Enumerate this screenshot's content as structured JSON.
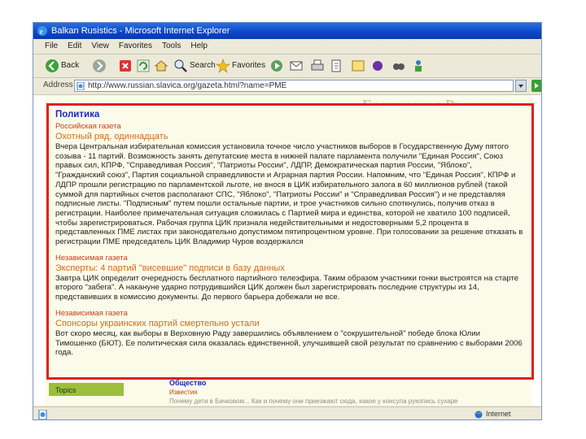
{
  "window": {
    "title": "Balkan Rusistics - Microsoft Internet Explorer"
  },
  "menu": [
    "File",
    "Edit",
    "View",
    "Favorites",
    "Tools",
    "Help"
  ],
  "toolbar": {
    "back_label": "Back",
    "search_label": "Search",
    "favorites_label": "Favorites"
  },
  "address": {
    "label": "Address",
    "url": "http://www.russian.slavica.org/gazeta.html?name=PME"
  },
  "page": {
    "faded_header": "Балканская Русистика",
    "section": "Политика",
    "articles": [
      {
        "source": "Российская газета",
        "headline": "Охотный ряд, одиннадцать",
        "text": "Вчера Центральная избирательная комиссия установила точное число участников выборов в Государственную Думу пятого созыва - 11 партий. Возможность занять депутатские места в нижней палате парламента получили \"Единая Россия\", Союз правых сил, КПРФ, \"Справедливая Россия\", \"Патриоты России\", ЛДПР, Демократическая партия России, \"Яблоко\", \"Гражданский союз\", Партия социальной справедливости и Аграрная партия России. Напомним, что \"Единая Россия\", КПРФ и ЛДПР прошли регистрацию по парламентской льготе, не внося в ЦИК избирательного залога в 60 миллионов рублей (такой суммой для партийных счетов располагают СПС, \"Яблоко\", \"Патриоты России\" и \"Справедливая Россия\") и не представляя подписные листы. \"Подписным\" путем пошли остальные партии, и трое участников сильно споткнулись, получив отказ в регистрации. Наиболее примечательная ситуация сложилась с Партией мира и единства, которой не хватило 100 подписей, чтобы зарегистрироваться. Рабочая группа ЦИК признала недействительными и недостоверными 5,2 процента в представленных ПМЕ листах при законодательно допустимом пятипроцентном уровне. При голосовании за решение отказать в регистрации ПМЕ председатель ЦИК Владимир Чуров воздержался"
      },
      {
        "source": "Независимая газета",
        "headline": "Эксперты: 4 партий \"висевшие\" подписи в базу данных",
        "text": "Завтра ЦИК определит очередность бесплатного партийного телеэфира. Таким образом участники гонки выстроятся на старте второго \"забега\". А накануне ударно потрудившийся ЦИК должен был зарегистрировать последние структуры из 14, представивших в комиссию документы. До первого барьера добежали не все."
      },
      {
        "source": "Независимая газета",
        "headline": "Спонсоры украинских партий смертельно устали",
        "text": "Вот скоро месяц, как выборы в Верховную Раду завершились объявлением о \"сокрушительной\" победе блока Юлии Тимошенко (БЮТ). Ее политическая сила оказалась единственной, улучшившей свой результат по сравнению с выборами 2006 года."
      }
    ],
    "topics_tab": "Topics",
    "below_section": "Общество",
    "below_source": "Известия",
    "below_text": "Почему дети в Бачковом... Как и почему они приезжают сюда, какое у консула рукопись сухаре"
  },
  "status": {
    "zone": "Internet"
  },
  "colors": {
    "highlight_border": "#e0201d",
    "section": "#1b26c9",
    "source": "#c63d1f",
    "headline": "#d36b18"
  },
  "icons": [
    "ie-logo-icon",
    "back-arrow-icon",
    "forward-arrow-icon",
    "stop-icon",
    "refresh-icon",
    "home-icon",
    "search-icon",
    "favorites-star-icon",
    "media-icon",
    "mail-icon",
    "print-icon",
    "edit-icon",
    "page-icon",
    "globe-icon"
  ]
}
